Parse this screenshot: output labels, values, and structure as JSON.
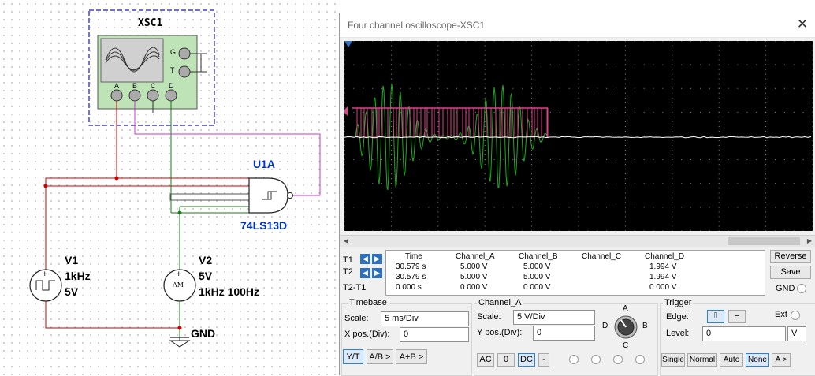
{
  "schematic": {
    "xsc_label": "XSC1",
    "xsc_terminals": [
      "G",
      "T"
    ],
    "xsc_channels": [
      "A",
      "B",
      "C",
      "D"
    ],
    "gate_ref": "U1A",
    "gate_part": "74LS13D",
    "v1": {
      "ref": "V1",
      "line1": "1kHz",
      "line2": "5V"
    },
    "v2": {
      "ref": "V2",
      "line1": "5V",
      "line2": "1kHz 100Hz",
      "symbol": "AM"
    },
    "gnd": "GND",
    "wire_colors": {
      "red": "#cc0000",
      "magenta": "#cc33cc",
      "green": "#1a7a1a",
      "blue_box": "#1a1aaa",
      "label_blue": "#0033cc"
    }
  },
  "window": {
    "title": "Four channel oscilloscope-XSC1",
    "close": "✕"
  },
  "readout": {
    "row_labels": [
      "T1",
      "T2",
      "T2-T1"
    ],
    "headers": [
      "Time",
      "Channel_A",
      "Channel_B",
      "Channel_C",
      "Channel_D"
    ],
    "rows": [
      [
        "30.579 s",
        "5.000 V",
        "5.000 V",
        "",
        "1.994 V"
      ],
      [
        "30.579 s",
        "5.000 V",
        "5.000 V",
        "",
        "1.994 V"
      ],
      [
        "0.000 s",
        "0.000 V",
        "0.000 V",
        "",
        "0.000 V"
      ]
    ],
    "reverse": "Reverse",
    "save": "Save",
    "gnd": "GND"
  },
  "timebase": {
    "title": "Timebase",
    "scale_label": "Scale:",
    "scale_value": "5 ms/Div",
    "xpos_label": "X pos.(Div):",
    "xpos_value": "0",
    "buttons": [
      "Y/T",
      "A/B >",
      "A+B >"
    ]
  },
  "channel": {
    "title": "Channel_A",
    "scale_label": "Scale:",
    "scale_value": "5  V/Div",
    "ypos_label": "Y pos.(Div):",
    "ypos_value": "0",
    "buttons": [
      "AC",
      "0",
      "DC",
      "-"
    ],
    "knob": [
      "A",
      "B",
      "C",
      "D"
    ]
  },
  "trigger": {
    "title": "Trigger",
    "edge_label": "Edge:",
    "ext_label": "Ext",
    "level_label": "Level:",
    "level_value": "0",
    "level_unit": "V",
    "modes": [
      "Single",
      "Normal",
      "Auto",
      "None"
    ],
    "mode_extra": "A >"
  },
  "trace_colors": {
    "channel_a": "#e0408a",
    "channel_b": "#22aa22",
    "channel_d": "#ffffff"
  }
}
